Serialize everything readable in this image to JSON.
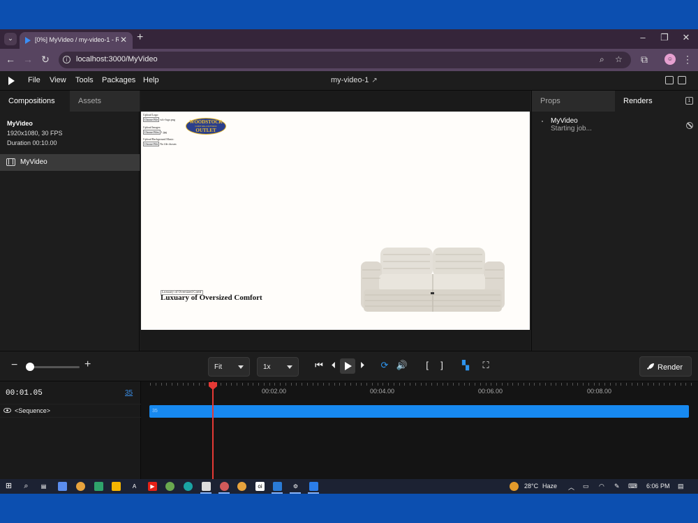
{
  "browser": {
    "tab_title": "[0%] MyVideo / my-video-1 - R",
    "url": "localhost:3000/MyVideo"
  },
  "app": {
    "menu": [
      "File",
      "View",
      "Tools",
      "Packages",
      "Help"
    ],
    "doc_title": "my-video-1"
  },
  "left_panel": {
    "tabs": [
      "Compositions",
      "Assets"
    ],
    "comp_name": "MyVideo",
    "comp_res": "1920x1080, 30 FPS",
    "comp_duration": "Duration 00:10.00",
    "comp_item": "MyVideo"
  },
  "canvas": {
    "upload_logo_label": "Upload Logo:",
    "upload_logo_btn": "Choose File",
    "upload_logo_file": "wfo-logo.png",
    "upload_images_label": "Upload Images:",
    "upload_images_btn": "Choose Files",
    "upload_images_file": "1.jpg",
    "upload_bg_label": "Upload Background Music:",
    "upload_bg_btn": "Choose File",
    "upload_bg_file": "No file chosen",
    "logo_top": "WOODSTOCK",
    "logo_mid": "FURNITURE & MATTRESS",
    "logo_bot": "OUTLET",
    "caption_input": "Luxuary of Oversized Comf",
    "headline": "Luxuary of Oversized Comfort"
  },
  "right_panel": {
    "tabs": [
      "Props",
      "Renders"
    ],
    "badge": "1",
    "render_name": "MyVideo",
    "render_status": "Starting job..."
  },
  "controls": {
    "fit": "Fit",
    "speed": "1x",
    "render_label": "Render",
    "zoom_level": 0.07
  },
  "timeline": {
    "timecode": "00:01.05",
    "frame": "35",
    "sequence_label": "<Sequence>",
    "bar_label": "35",
    "ticks": [
      "00:02.00",
      "00:04.00",
      "00:06.00",
      "00:08.00"
    ]
  },
  "taskbar": {
    "temperature": "28°C",
    "weather": "Haze",
    "time": "6:06 PM"
  },
  "colors": {
    "accent": "#1789f0",
    "playhead": "#e53935",
    "browser_chrome": "#574460"
  }
}
